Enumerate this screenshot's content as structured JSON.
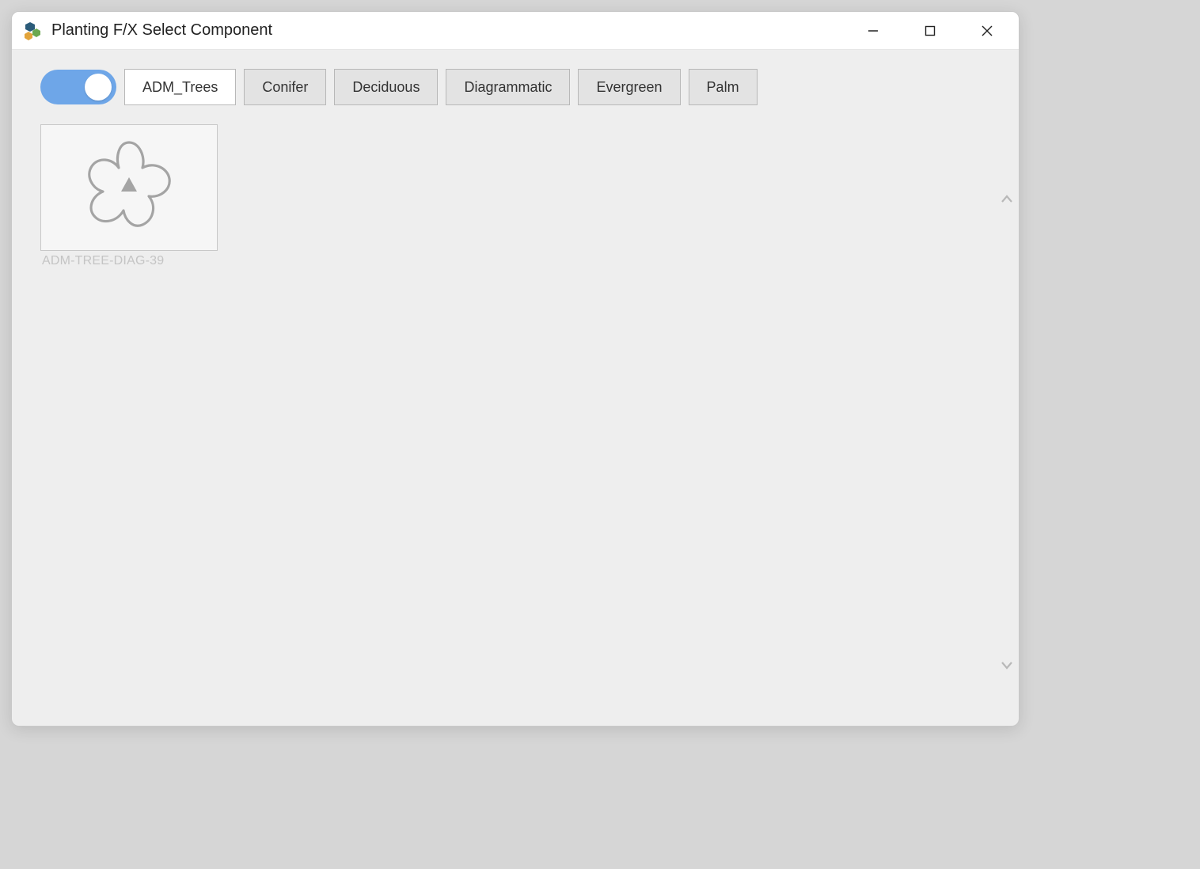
{
  "window": {
    "title": "Planting F/X Select Component"
  },
  "toolbar": {
    "toggle_on": true,
    "tabs": [
      {
        "label": "ADM_Trees",
        "active": true
      },
      {
        "label": "Conifer",
        "active": false
      },
      {
        "label": "Deciduous",
        "active": false
      },
      {
        "label": "Diagrammatic",
        "active": false
      },
      {
        "label": "Evergreen",
        "active": false
      },
      {
        "label": "Palm",
        "active": false
      }
    ]
  },
  "items": [
    {
      "name": "ADM-TREE-DIAG-39",
      "icon": "flower-diagram"
    }
  ]
}
